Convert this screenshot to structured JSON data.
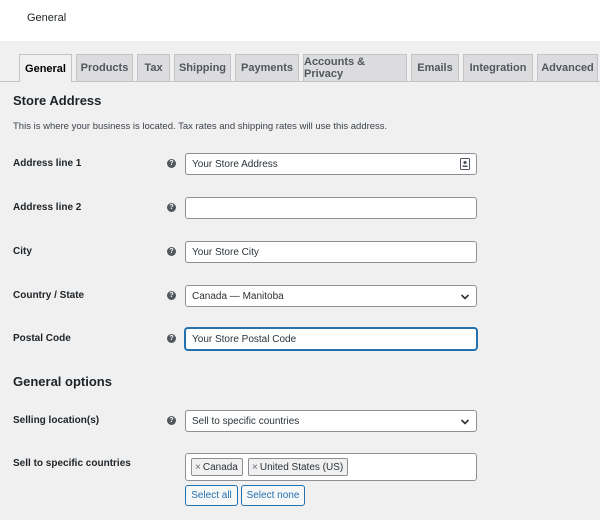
{
  "header": {
    "title": "General"
  },
  "tabs": [
    {
      "label": "General",
      "active": true
    },
    {
      "label": "Products"
    },
    {
      "label": "Tax"
    },
    {
      "label": "Shipping"
    },
    {
      "label": "Payments"
    },
    {
      "label": "Accounts & Privacy"
    },
    {
      "label": "Emails"
    },
    {
      "label": "Integration"
    },
    {
      "label": "Advanced"
    }
  ],
  "store_address": {
    "heading": "Store Address",
    "description": "This is where your business is located. Tax rates and shipping rates will use this address.",
    "address1": {
      "label": "Address line 1",
      "value": "Your Store Address"
    },
    "address2": {
      "label": "Address line 2",
      "value": ""
    },
    "city": {
      "label": "City",
      "value": "Your Store City"
    },
    "country": {
      "label": "Country / State",
      "value": "Canada — Manitoba"
    },
    "postal": {
      "label": "Postal Code",
      "value": "Your Store Postal Code"
    }
  },
  "general_options": {
    "heading": "General options",
    "selling_locations": {
      "label": "Selling location(s)",
      "value": "Sell to specific countries"
    },
    "specific_countries": {
      "label": "Sell to specific countries",
      "chips": [
        "Canada",
        "United States (US)"
      ],
      "chip_remove_glyph": "×",
      "select_all": "Select all",
      "select_none": "Select none"
    }
  },
  "help_glyph": "?",
  "colors": {
    "accent": "#2271b1",
    "background": "#f0f0f1",
    "tab_inactive": "#dcdcde"
  }
}
